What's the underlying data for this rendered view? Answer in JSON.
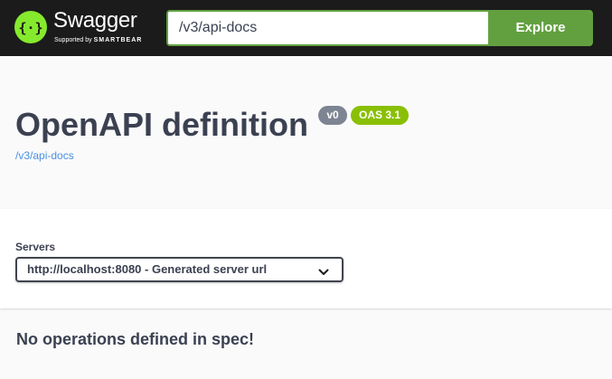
{
  "topbar": {
    "brand": "Swagger",
    "brand_sub_prefix": "Supported by",
    "brand_sub_name": "SMARTBEAR",
    "url_value": "/v3/api-docs",
    "explore_label": "Explore",
    "logo_icon": "swagger-logo-icon"
  },
  "info": {
    "title": "OpenAPI definition",
    "version_badge": "v0",
    "oas_badge": "OAS 3.1",
    "spec_link": "/v3/api-docs"
  },
  "servers": {
    "label": "Servers",
    "selected": "http://localhost:8080 - Generated server url"
  },
  "operations": {
    "empty_message": "No operations defined in spec!"
  },
  "colors": {
    "topbar_bg": "#1b1b1b",
    "accent_green": "#62a03f",
    "logo_green": "#85ea2d",
    "oas_badge": "#89bf04",
    "version_badge": "#7d8492",
    "link": "#4990e2",
    "text": "#3b4151"
  }
}
